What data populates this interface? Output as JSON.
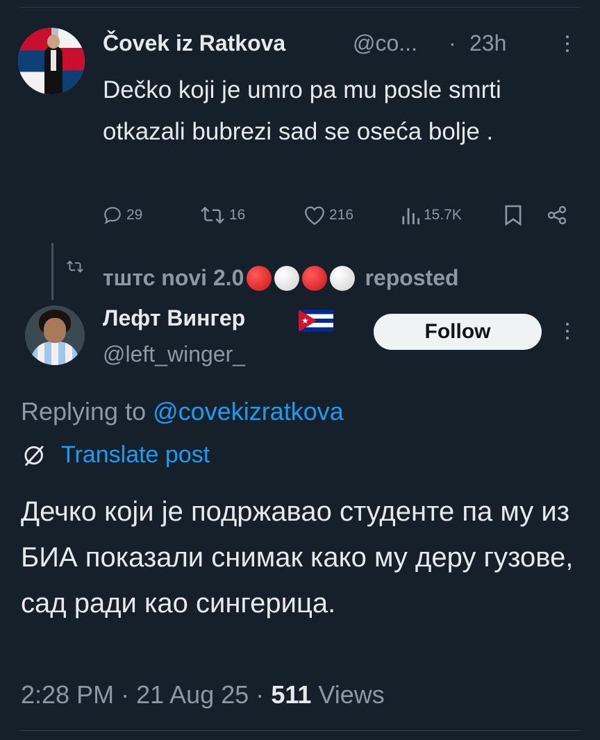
{
  "tweet1": {
    "author_name": "Čovek iz Ratkova",
    "handle": "@co...",
    "separator": "·",
    "time": "23h",
    "text": "Dečko koji je umro pa mu posle smrti otkazali bubrezi sad se oseća bolje .",
    "stats": {
      "replies": "29",
      "reposts": "16",
      "likes": "216",
      "views": "15.7K"
    }
  },
  "repost_banner": {
    "reposter": "тштс novi 2.0",
    "label": "reposted",
    "emoji": [
      "red-circle",
      "white-circle",
      "red-circle",
      "white-circle"
    ]
  },
  "tweet2": {
    "author_name": "Лефт Вингер",
    "flag": "cuba-flag",
    "handle": "@left_winger_",
    "follow_label": "Follow",
    "replying_prefix": "Replying to",
    "replying_to": "@covekizratkova",
    "translate_label": "Translate post",
    "text": "Дечко који је подржавао студенте па му из БИА показали снимак како му деру гузове, сад ради као сингерица.",
    "time": "2:28 PM",
    "date": "21 Aug 25",
    "views_count": "511",
    "views_label": "Views",
    "separator": "·"
  },
  "colors": {
    "background": "#15202b",
    "text": "#e7e9ea",
    "muted": "#8b98a5",
    "link": "#1d9bf0"
  }
}
